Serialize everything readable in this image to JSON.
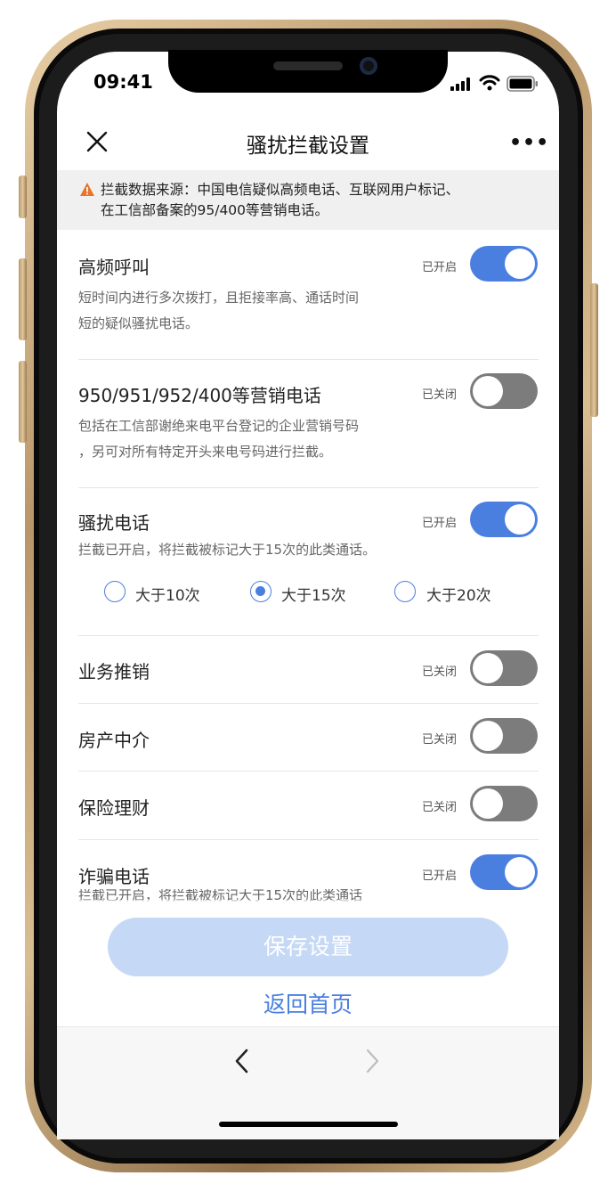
{
  "status_bar": {
    "time": "09:41"
  },
  "header": {
    "title": "骚扰拦截设置",
    "close_icon": "close-icon",
    "more_label": "•••"
  },
  "notice": {
    "line1": "拦截数据来源：中国电信疑似高频电话、互联网用户标记、",
    "line2": "在工信部备案的95/400等营销电话。"
  },
  "rows": [
    {
      "title": "高频呼叫",
      "state": "已开启",
      "on": true,
      "desc1": "短时间内进行多次拨打，且拒接率高、通话时间",
      "desc2": "短的疑似骚扰电话。"
    },
    {
      "title": "950/951/952/400等营销电话",
      "state": "已关闭",
      "on": false,
      "desc1": "包括在工信部谢绝来电平台登记的企业营销号码",
      "desc2": "，另可对所有特定开头来电号码进行拦截。"
    },
    {
      "title": "骚扰电话",
      "state": "已开启",
      "on": true,
      "desc1": "拦截已开启，将拦截被标记大于15次的此类通话。"
    },
    {
      "title": "业务推销",
      "state": "已关闭",
      "on": false
    },
    {
      "title": "房产中介",
      "state": "已关闭",
      "on": false
    },
    {
      "title": "保险理财",
      "state": "已关闭",
      "on": false
    },
    {
      "title": "诈骗电话",
      "state": "已开启",
      "on": true,
      "desc1": "拦截已开启，将拦截被标记大于15次的此类通话"
    }
  ],
  "threshold_options": [
    {
      "label": "大于10次",
      "selected": false
    },
    {
      "label": "大于15次",
      "selected": true
    },
    {
      "label": "大于20次",
      "selected": false
    }
  ],
  "footer": {
    "save_label": "保存设置",
    "home_label": "返回首页"
  },
  "colors": {
    "accent": "#4a7fe0",
    "toggle_off": "#7c7c7c",
    "save_disabled": "#c5d9f6"
  }
}
